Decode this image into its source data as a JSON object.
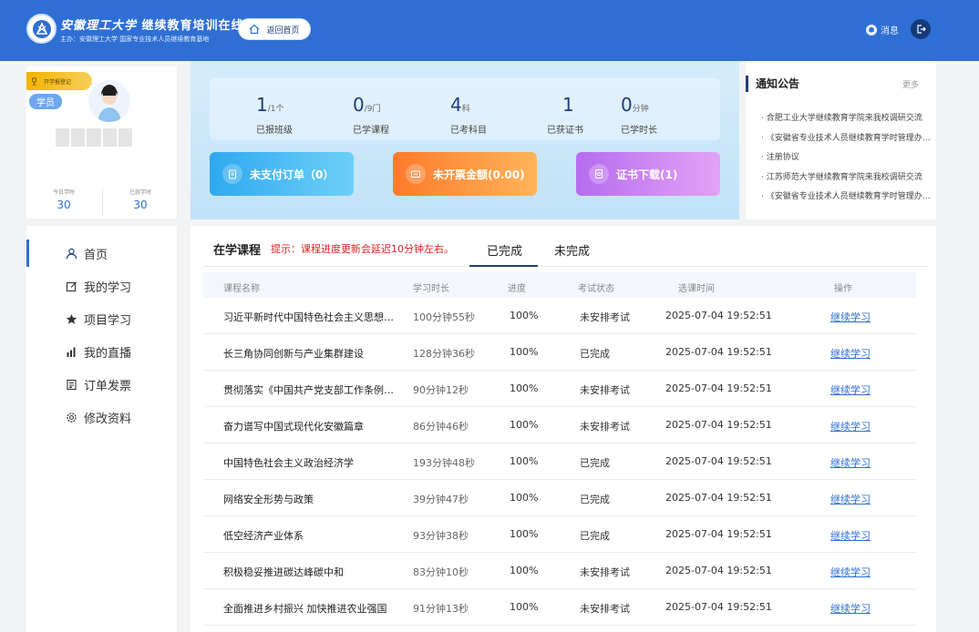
{
  "header": {
    "brand_calli": "安徽理工大学",
    "brand_main": "继续教育培训在线",
    "brand_sub": "主办：安徽理工大学   国家专业技术人员继续教育基地",
    "home_button": "返回首页",
    "message_label": "消息",
    "icons": [
      "university-logo",
      "home-icon",
      "bell-icon",
      "logout-icon"
    ],
    "colors": {
      "primary": "#2f6fd4",
      "dark": "#163b7c"
    }
  },
  "profile": {
    "reg_badge": "开学报登记",
    "role": "学员",
    "today_hours_label": "今日学时",
    "today_hours": "30",
    "earned_hours_label": "已获学时",
    "earned_hours": "30"
  },
  "stats": [
    {
      "value": "1",
      "unit": "/1个",
      "label": "已报班级"
    },
    {
      "value": "0",
      "unit": "/9门",
      "label": "已学课程"
    },
    {
      "value": "4",
      "unit": "科",
      "label": "已考科目"
    },
    {
      "value": "1",
      "unit": "",
      "label": "已获证书"
    },
    {
      "value": "0",
      "unit": "分钟",
      "label": "已学时长"
    }
  ],
  "actions": {
    "unpaid": "未支付订单（0）",
    "invoice": "未开票金额(0.00)",
    "certificate": "证书下载(1)"
  },
  "notice": {
    "title": "通知公告",
    "more": "更多",
    "items": [
      "合肥工业大学继续教育学院来我校调研交流",
      "《安徽省专业技术人员继续教育学时管理办法》",
      "注册协议",
      "江苏师范大学继续教育学院来我校调研交流",
      "《安徽省专业技术人员继续教育学时管理办法》"
    ]
  },
  "sidebar": {
    "items": [
      {
        "label": "首页",
        "icon": "user-icon"
      },
      {
        "label": "我的学习",
        "icon": "edit-icon"
      },
      {
        "label": "项目学习",
        "icon": "star-icon"
      },
      {
        "label": "我的直播",
        "icon": "bar-chart-icon"
      },
      {
        "label": "订单发票",
        "icon": "receipt-icon"
      },
      {
        "label": "修改资料",
        "icon": "gear-icon"
      }
    ]
  },
  "courses": {
    "title": "在学课程",
    "tip": "提示：课程进度更新会延迟10分钟左右。",
    "tab_done": "已完成",
    "tab_undone": "未完成",
    "columns": [
      "课程名称",
      "学习时长",
      "进度",
      "考试状态",
      "选课时间",
      "操作"
    ],
    "rows": [
      {
        "name": "习近平新时代中国特色社会主义思想概论",
        "duration": "100分钟55秒",
        "progress": "100%",
        "exam": "未安排考试",
        "time": "2025-07-04 19:52:51",
        "op": "继续学习"
      },
      {
        "name": "长三角协同创新与产业集群建设",
        "duration": "128分钟36秒",
        "progress": "100%",
        "exam": "已完成",
        "time": "2025-07-04 19:52:51",
        "op": "继续学习"
      },
      {
        "name": "贯彻落实《中国共产党支部工作条例（试行）》",
        "duration": "90分钟12秒",
        "progress": "100%",
        "exam": "未安排考试",
        "time": "2025-07-04 19:52:51",
        "op": "继续学习"
      },
      {
        "name": "奋力谱写中国式现代化安徽篇章",
        "duration": "86分钟46秒",
        "progress": "100%",
        "exam": "未安排考试",
        "time": "2025-07-04 19:52:51",
        "op": "继续学习"
      },
      {
        "name": "中国特色社会主义政治经济学",
        "duration": "193分钟48秒",
        "progress": "100%",
        "exam": "已完成",
        "time": "2025-07-04 19:52:51",
        "op": "继续学习"
      },
      {
        "name": "网络安全形势与政策",
        "duration": "39分钟47秒",
        "progress": "100%",
        "exam": "已完成",
        "time": "2025-07-04 19:52:51",
        "op": "继续学习"
      },
      {
        "name": "低空经济产业体系",
        "duration": "93分钟38秒",
        "progress": "100%",
        "exam": "已完成",
        "time": "2025-07-04 19:52:51",
        "op": "继续学习"
      },
      {
        "name": "积极稳妥推进碳达峰碳中和",
        "duration": "83分钟10秒",
        "progress": "100%",
        "exam": "未安排考试",
        "time": "2025-07-04 19:52:51",
        "op": "继续学习"
      },
      {
        "name": "全面推进乡村振兴 加快推进农业强国",
        "duration": "91分钟13秒",
        "progress": "100%",
        "exam": "未安排考试",
        "time": "2025-07-04 19:52:51",
        "op": "继续学习"
      }
    ]
  }
}
